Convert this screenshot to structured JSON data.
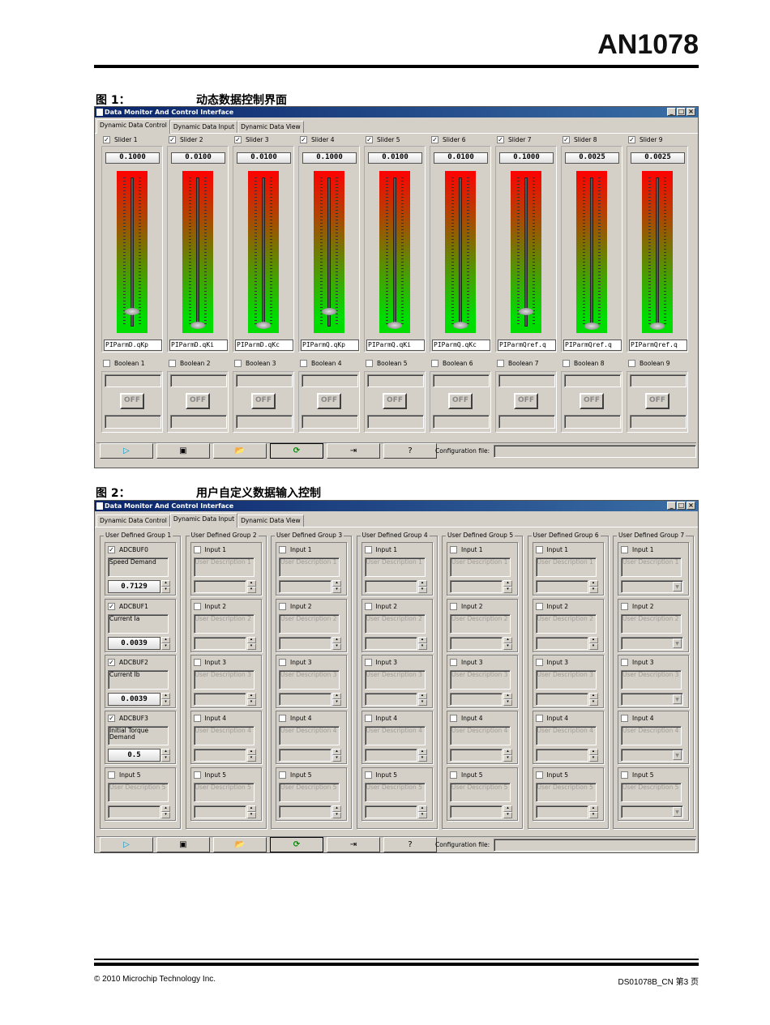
{
  "doc": {
    "title": "AN1078",
    "footer_left": "© 2010 Microchip Technology Inc.",
    "footer_right": "DS01078B_CN 第3 页"
  },
  "fig1": {
    "label": "图 1：",
    "caption": "动态数据控制界面"
  },
  "fig2": {
    "label": "图 2：",
    "caption": "用户自定义数据输入控制"
  },
  "window": {
    "title": "Data Monitor And Control Interface",
    "buttons": [
      "_",
      "□",
      "×"
    ]
  },
  "tabs": [
    "Dynamic Data Control",
    "Dynamic Data Input",
    "Dynamic Data View"
  ],
  "sliders": [
    {
      "label": "Slider 1",
      "checked": true,
      "value": "0.1000",
      "level": 0.1,
      "name": "PIParmD.qKp"
    },
    {
      "label": "Slider 2",
      "checked": true,
      "value": "0.0100",
      "level": 0.01,
      "name": "PIParmD.qKi"
    },
    {
      "label": "Slider 3",
      "checked": true,
      "value": "0.0100",
      "level": 0.01,
      "name": "PIParmD.qKc"
    },
    {
      "label": "Slider 4",
      "checked": true,
      "value": "0.1000",
      "level": 0.1,
      "name": "PIParmQ.qKp"
    },
    {
      "label": "Slider 5",
      "checked": true,
      "value": "0.0100",
      "level": 0.01,
      "name": "PIParmQ.qKi"
    },
    {
      "label": "Slider 6",
      "checked": true,
      "value": "0.0100",
      "level": 0.01,
      "name": "PIParmQ.qKc"
    },
    {
      "label": "Slider 7",
      "checked": true,
      "value": "0.1000",
      "level": 0.1,
      "name": "PIParmQref.q"
    },
    {
      "label": "Slider 8",
      "checked": true,
      "value": "0.0025",
      "level": 0.0025,
      "name": "PIParmQref.q"
    },
    {
      "label": "Slider 9",
      "checked": true,
      "value": "0.0025",
      "level": 0.0025,
      "name": "PIParmQref.q"
    }
  ],
  "booleans": [
    {
      "label": "Boolean 1",
      "state": "OFF"
    },
    {
      "label": "Boolean 2",
      "state": "OFF"
    },
    {
      "label": "Boolean 3",
      "state": "OFF"
    },
    {
      "label": "Boolean 4",
      "state": "OFF"
    },
    {
      "label": "Boolean 5",
      "state": "OFF"
    },
    {
      "label": "Boolean 6",
      "state": "OFF"
    },
    {
      "label": "Boolean 7",
      "state": "OFF"
    },
    {
      "label": "Boolean 8",
      "state": "OFF"
    },
    {
      "label": "Boolean 9",
      "state": "OFF"
    }
  ],
  "toolbar": {
    "buttons": [
      {
        "icon": "play-icon",
        "glyph": "▷"
      },
      {
        "icon": "save-icon",
        "glyph": "▣"
      },
      {
        "icon": "open-folder-icon",
        "glyph": "📂"
      },
      {
        "icon": "refresh-icon",
        "glyph": "⟳"
      },
      {
        "icon": "exit-icon",
        "glyph": "⇥"
      },
      {
        "icon": "help-icon",
        "glyph": "?"
      }
    ],
    "config_label": "Configuration file:",
    "config_value": ""
  },
  "groups": [
    {
      "label": "User Defined Group 1",
      "control": "spin",
      "inputs": [
        {
          "label": "ADCBUF0",
          "checked": true,
          "desc": "Speed Demand",
          "value": "0.7129",
          "enabled": true
        },
        {
          "label": "ADCBUF1",
          "checked": true,
          "desc": "Current Ia",
          "value": "0.0039",
          "enabled": true
        },
        {
          "label": "ADCBUF2",
          "checked": true,
          "desc": "Current Ib",
          "value": "0.0039",
          "enabled": true
        },
        {
          "label": "ADCBUF3",
          "checked": true,
          "desc": "Initial Torque Demand",
          "value": "0.5",
          "enabled": true
        },
        {
          "label": "Input 5",
          "checked": false,
          "desc": "User Description 5",
          "value": "",
          "enabled": false
        }
      ]
    },
    {
      "label": "User Defined Group 2",
      "control": "spin",
      "inputs": [
        {
          "label": "Input 1",
          "desc": "User Description 1"
        },
        {
          "label": "Input 2",
          "desc": "User Description 2"
        },
        {
          "label": "Input 3",
          "desc": "User Description 3"
        },
        {
          "label": "Input 4",
          "desc": "User Description 4"
        },
        {
          "label": "Input 5",
          "desc": "User Description 5"
        }
      ]
    },
    {
      "label": "User Defined Group 3",
      "control": "spin",
      "inputs": [
        {
          "label": "Input 1",
          "desc": "User Description 1"
        },
        {
          "label": "Input 2",
          "desc": "User Description 2"
        },
        {
          "label": "Input 3",
          "desc": "User Description 3"
        },
        {
          "label": "Input 4",
          "desc": "User Description 4"
        },
        {
          "label": "Input 5",
          "desc": "User Description 5"
        }
      ]
    },
    {
      "label": "User Defined Group 4",
      "control": "spin",
      "inputs": [
        {
          "label": "Input 1",
          "desc": "User Description 1"
        },
        {
          "label": "Input 2",
          "desc": "User Description 2"
        },
        {
          "label": "Input 3",
          "desc": "User Description 3"
        },
        {
          "label": "Input 4",
          "desc": "User Description 4"
        },
        {
          "label": "Input 5",
          "desc": "User Description 5"
        }
      ]
    },
    {
      "label": "User Defined Group 5",
      "control": "spin",
      "inputs": [
        {
          "label": "Input 1",
          "desc": "User Description 1"
        },
        {
          "label": "Input 2",
          "desc": "User Description 2"
        },
        {
          "label": "Input 3",
          "desc": "User Description 3"
        },
        {
          "label": "Input 4",
          "desc": "User Description 4"
        },
        {
          "label": "Input 5",
          "desc": "User Description 5"
        }
      ]
    },
    {
      "label": "User Defined Group 6",
      "control": "spin",
      "inputs": [
        {
          "label": "Input 1",
          "desc": "User Description 1"
        },
        {
          "label": "Input 2",
          "desc": "User Description 2"
        },
        {
          "label": "Input 3",
          "desc": "User Description 3"
        },
        {
          "label": "Input 4",
          "desc": "User Description 4"
        },
        {
          "label": "Input 5",
          "desc": "User Description 5"
        }
      ]
    },
    {
      "label": "User Defined Group 7",
      "control": "dropdown",
      "inputs": [
        {
          "label": "Input 1",
          "desc": "User Description 1"
        },
        {
          "label": "Input 2",
          "desc": "User Description 2"
        },
        {
          "label": "Input 3",
          "desc": "User Description 3"
        },
        {
          "label": "Input 4",
          "desc": "User Description 4"
        },
        {
          "label": "Input 5",
          "desc": "User Description 5"
        }
      ]
    }
  ]
}
